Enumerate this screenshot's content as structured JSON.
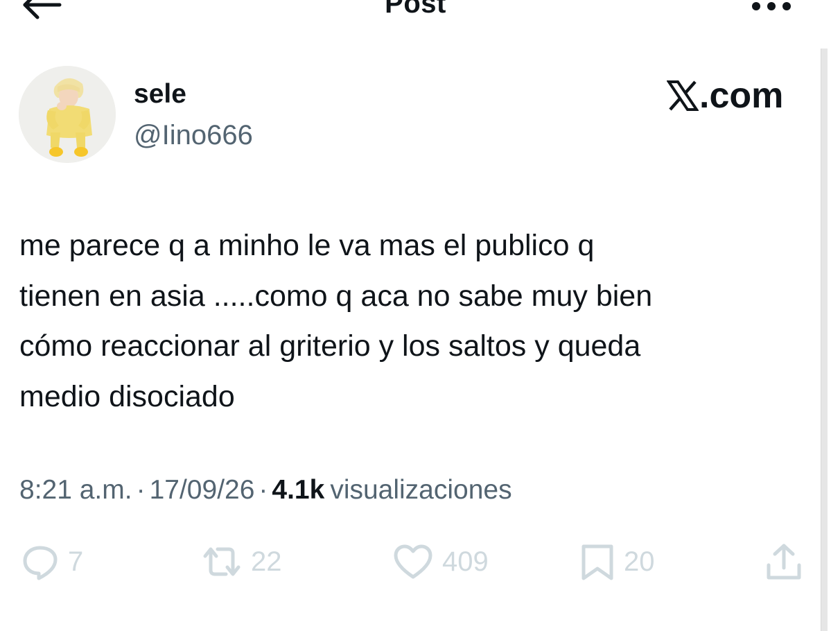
{
  "header": {
    "title": "Post",
    "back_icon": "arrow-left-icon",
    "more_icon": "more-horizontal-icon"
  },
  "author": {
    "display_name": "sele",
    "handle": "@Iino666",
    "avatar": "profile-photo"
  },
  "watermark": {
    "text": ".com",
    "logo_icon": "x-logo-icon"
  },
  "post": {
    "text": "me parece q a minho le va mas el publico q\ntienen en asia .....como q aca no sabe muy bien\ncómo reaccionar al griterio y los saltos y queda\nmedio disociado"
  },
  "meta": {
    "time": "8:21 a.m.",
    "separator": "·",
    "date": "17/09/26",
    "views_count": "4.1k",
    "views_label": "visualizaciones"
  },
  "actions": {
    "replies": {
      "icon": "reply-icon",
      "count": "7"
    },
    "reposts": {
      "icon": "repost-icon",
      "count": "22"
    },
    "likes": {
      "icon": "heart-icon",
      "count": "409"
    },
    "bookmarks": {
      "icon": "bookmark-icon",
      "count": "20"
    },
    "share": {
      "icon": "share-icon"
    }
  },
  "colors": {
    "text_primary": "#0f1419",
    "text_secondary": "#536471",
    "action_gray": "#cfd9de",
    "background": "#ffffff"
  }
}
